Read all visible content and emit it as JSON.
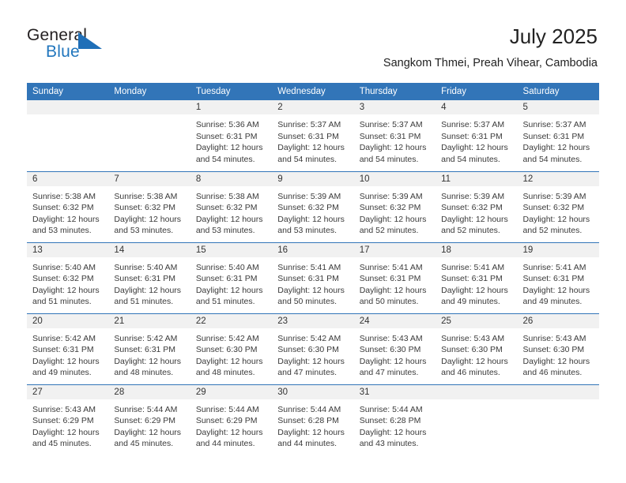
{
  "brand": {
    "word_one": "General",
    "word_two": "Blue",
    "triangle_color": "#1f6fb8",
    "blue": "#2176bd"
  },
  "header": {
    "title": "July 2025",
    "subtitle": "Sangkom Thmei, Preah Vihear, Cambodia",
    "accent_color": "#3275b8"
  },
  "calendar": {
    "weekdays": [
      "Sunday",
      "Monday",
      "Tuesday",
      "Wednesday",
      "Thursday",
      "Friday",
      "Saturday"
    ],
    "weeks": [
      [
        {
          "day": "",
          "sunrise": "",
          "sunset": "",
          "daylight_1": "",
          "daylight_2": ""
        },
        {
          "day": "",
          "sunrise": "",
          "sunset": "",
          "daylight_1": "",
          "daylight_2": ""
        },
        {
          "day": "1",
          "sunrise": "Sunrise: 5:36 AM",
          "sunset": "Sunset: 6:31 PM",
          "daylight_1": "Daylight: 12 hours",
          "daylight_2": "and 54 minutes."
        },
        {
          "day": "2",
          "sunrise": "Sunrise: 5:37 AM",
          "sunset": "Sunset: 6:31 PM",
          "daylight_1": "Daylight: 12 hours",
          "daylight_2": "and 54 minutes."
        },
        {
          "day": "3",
          "sunrise": "Sunrise: 5:37 AM",
          "sunset": "Sunset: 6:31 PM",
          "daylight_1": "Daylight: 12 hours",
          "daylight_2": "and 54 minutes."
        },
        {
          "day": "4",
          "sunrise": "Sunrise: 5:37 AM",
          "sunset": "Sunset: 6:31 PM",
          "daylight_1": "Daylight: 12 hours",
          "daylight_2": "and 54 minutes."
        },
        {
          "day": "5",
          "sunrise": "Sunrise: 5:37 AM",
          "sunset": "Sunset: 6:31 PM",
          "daylight_1": "Daylight: 12 hours",
          "daylight_2": "and 54 minutes."
        }
      ],
      [
        {
          "day": "6",
          "sunrise": "Sunrise: 5:38 AM",
          "sunset": "Sunset: 6:32 PM",
          "daylight_1": "Daylight: 12 hours",
          "daylight_2": "and 53 minutes."
        },
        {
          "day": "7",
          "sunrise": "Sunrise: 5:38 AM",
          "sunset": "Sunset: 6:32 PM",
          "daylight_1": "Daylight: 12 hours",
          "daylight_2": "and 53 minutes."
        },
        {
          "day": "8",
          "sunrise": "Sunrise: 5:38 AM",
          "sunset": "Sunset: 6:32 PM",
          "daylight_1": "Daylight: 12 hours",
          "daylight_2": "and 53 minutes."
        },
        {
          "day": "9",
          "sunrise": "Sunrise: 5:39 AM",
          "sunset": "Sunset: 6:32 PM",
          "daylight_1": "Daylight: 12 hours",
          "daylight_2": "and 53 minutes."
        },
        {
          "day": "10",
          "sunrise": "Sunrise: 5:39 AM",
          "sunset": "Sunset: 6:32 PM",
          "daylight_1": "Daylight: 12 hours",
          "daylight_2": "and 52 minutes."
        },
        {
          "day": "11",
          "sunrise": "Sunrise: 5:39 AM",
          "sunset": "Sunset: 6:32 PM",
          "daylight_1": "Daylight: 12 hours",
          "daylight_2": "and 52 minutes."
        },
        {
          "day": "12",
          "sunrise": "Sunrise: 5:39 AM",
          "sunset": "Sunset: 6:32 PM",
          "daylight_1": "Daylight: 12 hours",
          "daylight_2": "and 52 minutes."
        }
      ],
      [
        {
          "day": "13",
          "sunrise": "Sunrise: 5:40 AM",
          "sunset": "Sunset: 6:32 PM",
          "daylight_1": "Daylight: 12 hours",
          "daylight_2": "and 51 minutes."
        },
        {
          "day": "14",
          "sunrise": "Sunrise: 5:40 AM",
          "sunset": "Sunset: 6:31 PM",
          "daylight_1": "Daylight: 12 hours",
          "daylight_2": "and 51 minutes."
        },
        {
          "day": "15",
          "sunrise": "Sunrise: 5:40 AM",
          "sunset": "Sunset: 6:31 PM",
          "daylight_1": "Daylight: 12 hours",
          "daylight_2": "and 51 minutes."
        },
        {
          "day": "16",
          "sunrise": "Sunrise: 5:41 AM",
          "sunset": "Sunset: 6:31 PM",
          "daylight_1": "Daylight: 12 hours",
          "daylight_2": "and 50 minutes."
        },
        {
          "day": "17",
          "sunrise": "Sunrise: 5:41 AM",
          "sunset": "Sunset: 6:31 PM",
          "daylight_1": "Daylight: 12 hours",
          "daylight_2": "and 50 minutes."
        },
        {
          "day": "18",
          "sunrise": "Sunrise: 5:41 AM",
          "sunset": "Sunset: 6:31 PM",
          "daylight_1": "Daylight: 12 hours",
          "daylight_2": "and 49 minutes."
        },
        {
          "day": "19",
          "sunrise": "Sunrise: 5:41 AM",
          "sunset": "Sunset: 6:31 PM",
          "daylight_1": "Daylight: 12 hours",
          "daylight_2": "and 49 minutes."
        }
      ],
      [
        {
          "day": "20",
          "sunrise": "Sunrise: 5:42 AM",
          "sunset": "Sunset: 6:31 PM",
          "daylight_1": "Daylight: 12 hours",
          "daylight_2": "and 49 minutes."
        },
        {
          "day": "21",
          "sunrise": "Sunrise: 5:42 AM",
          "sunset": "Sunset: 6:31 PM",
          "daylight_1": "Daylight: 12 hours",
          "daylight_2": "and 48 minutes."
        },
        {
          "day": "22",
          "sunrise": "Sunrise: 5:42 AM",
          "sunset": "Sunset: 6:30 PM",
          "daylight_1": "Daylight: 12 hours",
          "daylight_2": "and 48 minutes."
        },
        {
          "day": "23",
          "sunrise": "Sunrise: 5:42 AM",
          "sunset": "Sunset: 6:30 PM",
          "daylight_1": "Daylight: 12 hours",
          "daylight_2": "and 47 minutes."
        },
        {
          "day": "24",
          "sunrise": "Sunrise: 5:43 AM",
          "sunset": "Sunset: 6:30 PM",
          "daylight_1": "Daylight: 12 hours",
          "daylight_2": "and 47 minutes."
        },
        {
          "day": "25",
          "sunrise": "Sunrise: 5:43 AM",
          "sunset": "Sunset: 6:30 PM",
          "daylight_1": "Daylight: 12 hours",
          "daylight_2": "and 46 minutes."
        },
        {
          "day": "26",
          "sunrise": "Sunrise: 5:43 AM",
          "sunset": "Sunset: 6:30 PM",
          "daylight_1": "Daylight: 12 hours",
          "daylight_2": "and 46 minutes."
        }
      ],
      [
        {
          "day": "27",
          "sunrise": "Sunrise: 5:43 AM",
          "sunset": "Sunset: 6:29 PM",
          "daylight_1": "Daylight: 12 hours",
          "daylight_2": "and 45 minutes."
        },
        {
          "day": "28",
          "sunrise": "Sunrise: 5:44 AM",
          "sunset": "Sunset: 6:29 PM",
          "daylight_1": "Daylight: 12 hours",
          "daylight_2": "and 45 minutes."
        },
        {
          "day": "29",
          "sunrise": "Sunrise: 5:44 AM",
          "sunset": "Sunset: 6:29 PM",
          "daylight_1": "Daylight: 12 hours",
          "daylight_2": "and 44 minutes."
        },
        {
          "day": "30",
          "sunrise": "Sunrise: 5:44 AM",
          "sunset": "Sunset: 6:28 PM",
          "daylight_1": "Daylight: 12 hours",
          "daylight_2": "and 44 minutes."
        },
        {
          "day": "31",
          "sunrise": "Sunrise: 5:44 AM",
          "sunset": "Sunset: 6:28 PM",
          "daylight_1": "Daylight: 12 hours",
          "daylight_2": "and 43 minutes."
        },
        {
          "day": "",
          "sunrise": "",
          "sunset": "",
          "daylight_1": "",
          "daylight_2": ""
        },
        {
          "day": "",
          "sunrise": "",
          "sunset": "",
          "daylight_1": "",
          "daylight_2": ""
        }
      ]
    ]
  }
}
